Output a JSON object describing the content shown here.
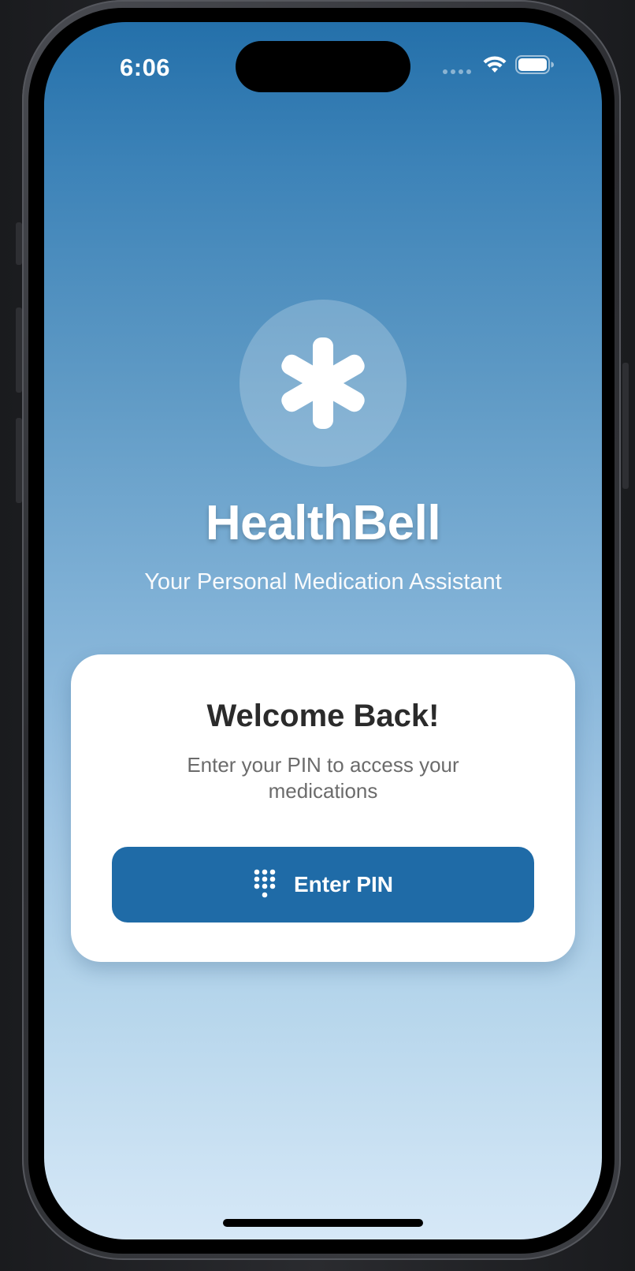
{
  "status_bar": {
    "time": "6:06",
    "icons": [
      "cellular-signal-icon",
      "wifi-icon",
      "battery-icon"
    ]
  },
  "app": {
    "logo_icon": "medical-asterisk-icon",
    "title": "HealthBell",
    "subtitle": "Your Personal Medication Assistant"
  },
  "login_card": {
    "title": "Welcome Back!",
    "subtitle": "Enter your PIN to access your medications",
    "button_label": "Enter PIN",
    "button_icon": "keypad-icon"
  },
  "colors": {
    "accent": "#1f6ba7",
    "gradient_top": "#2470aa",
    "gradient_bottom": "#d6e8f7",
    "card_background": "#ffffff"
  }
}
